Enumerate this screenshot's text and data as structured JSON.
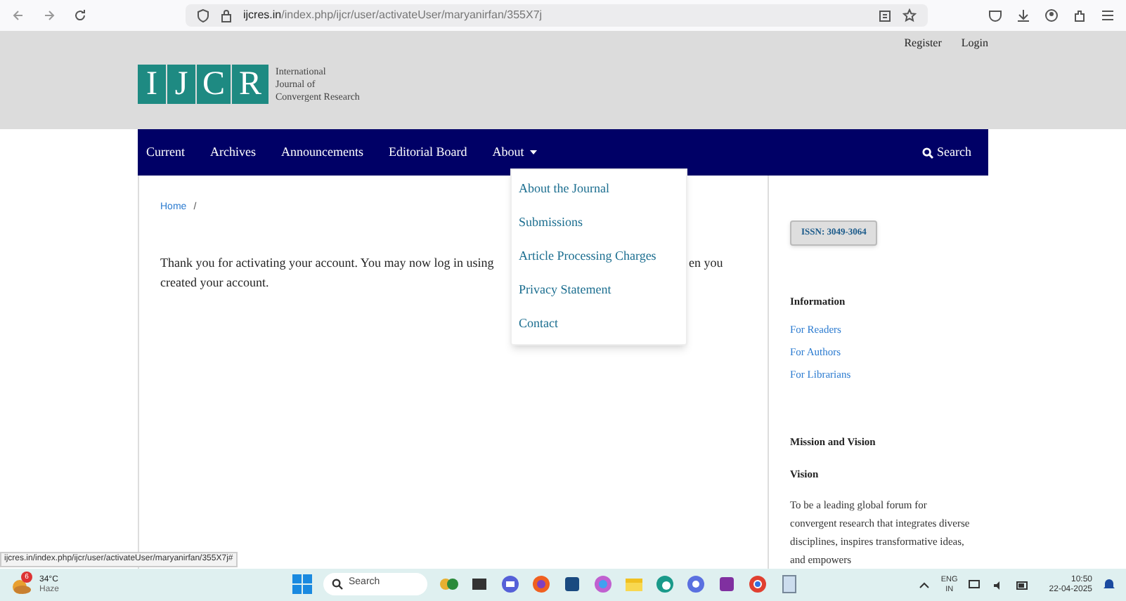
{
  "browser": {
    "url_host": "ijcres.in",
    "url_path": "/index.php/ijcr/user/activateUser/maryanirfan/355X7j"
  },
  "header": {
    "user_links": [
      "Register",
      "Login"
    ],
    "logo_letters": [
      "I",
      "J",
      "C",
      "R"
    ],
    "logo_title": [
      "International",
      "Journal of",
      "Convergent Research"
    ]
  },
  "nav": {
    "items": [
      {
        "label": "Current"
      },
      {
        "label": "Archives"
      },
      {
        "label": "Announcements"
      },
      {
        "label": "Editorial Board"
      },
      {
        "label": "About",
        "expanded": true,
        "kind": "dropdown"
      }
    ],
    "search": "Search"
  },
  "dropdown": [
    "About the Journal",
    "Submissions",
    "Article Processing Charges",
    "Privacy Statement",
    "Contact"
  ],
  "breadcrumb": {
    "home": "Home",
    "separator": "/"
  },
  "message": {
    "line_start": "Thank you for activating your account. You may now log in using",
    "line_end_fragment": "en you",
    "line_2": "created your account."
  },
  "sidebar": {
    "issn": "ISSN: 3049-3064",
    "information_title": "Information",
    "information_links": [
      "For Readers",
      "For Authors",
      "For Librarians"
    ],
    "mission_title": "Mission and Vision",
    "vision_title": "Vision",
    "vision_text": "To be a leading global forum for convergent research that integrates diverse disciplines, inspires transformative ideas, and empowers"
  },
  "status_url": "ijcres.in/index.php/ijcr/user/activateUser/maryanirfan/355X7j#",
  "taskbar": {
    "weather_badge": "6",
    "temperature": "34°C",
    "condition": "Haze",
    "search": "Search",
    "language": "ENG",
    "region": "IN",
    "time": "10:50",
    "date": "22-04-2025"
  }
}
